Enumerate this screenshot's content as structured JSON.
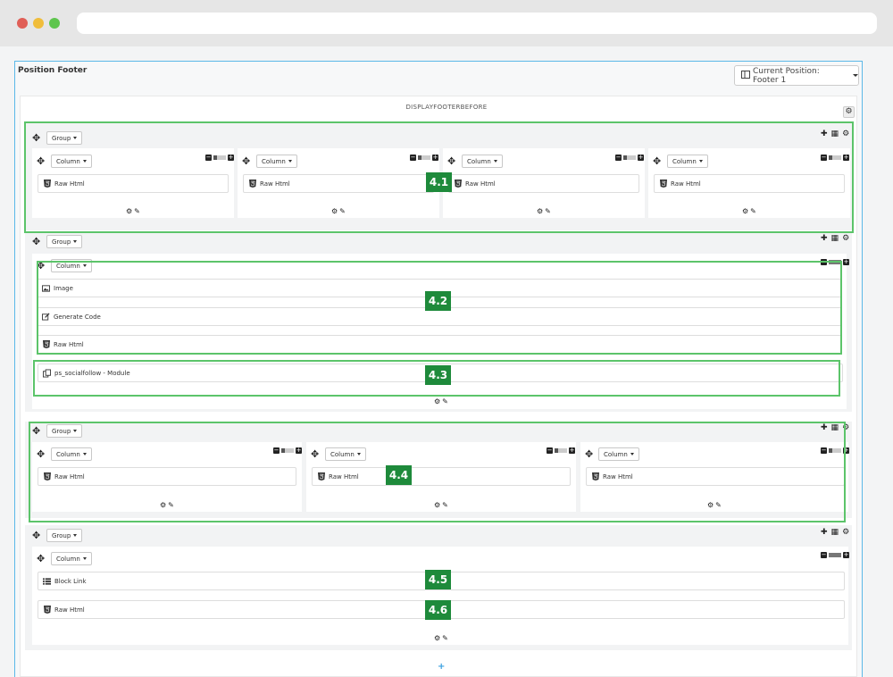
{
  "window": {
    "dots": [
      "#e05f57",
      "#f0bd3b",
      "#5ec54d"
    ]
  },
  "page": {
    "title": "Position Footer",
    "current_position_label": "Current Position: Footer 1",
    "hook_name": "DISPLAYFOOTERBEFORE",
    "group_label": "Group",
    "column_label": "Column"
  },
  "widgets": {
    "raw_html": "Raw Html",
    "image": "Image",
    "generate_code": "Generate Code",
    "module": "ps_socialfollow - Module",
    "block_link": "Block Link"
  },
  "badges": {
    "b1": "4.1",
    "b2": "4.2",
    "b3": "4.3",
    "b4": "4.4",
    "b5": "4.5",
    "b6": "4.6"
  },
  "colors": {
    "highlight": "#5cc46a",
    "badge": "#1e8a3b",
    "frame_border": "#5bb8e8"
  }
}
